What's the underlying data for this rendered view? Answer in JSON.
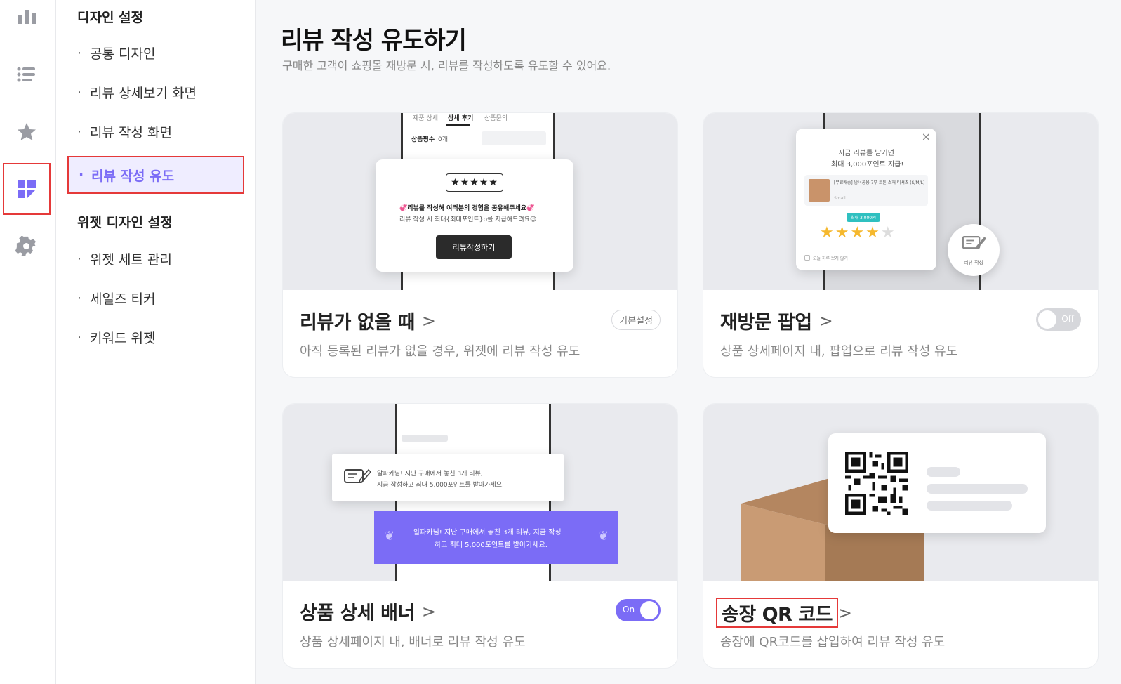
{
  "rail": {
    "items": [
      {
        "name": "chart-icon"
      },
      {
        "name": "list-icon"
      },
      {
        "name": "star-icon"
      },
      {
        "name": "widget-icon",
        "active": true
      },
      {
        "name": "gear-icon"
      }
    ]
  },
  "submenu": {
    "group1": "디자인 설정",
    "items1": [
      "공통 디자인",
      "리뷰 상세보기 화면",
      "리뷰 작성 화면",
      "리뷰 작성 유도"
    ],
    "group2": "위젯 디자인 설정",
    "items2": [
      "위젯 세트 관리",
      "세일즈 티커",
      "키워드 위젯"
    ],
    "bullet": "·"
  },
  "page": {
    "title": "리뷰 작성 유도하기",
    "subtitle": "구매한 고객이 쇼핑몰 재방문 시, 리뷰를 작성하도록 유도할 수 있어요."
  },
  "cards": [
    {
      "title": "리뷰가 없을 때",
      "desc": "아직 등록된 리뷰가 없을 경우, 위젯에 리뷰 작성 유도",
      "badge": "기본설정",
      "preview": {
        "tabs": [
          "제품 상세",
          "상세 후기",
          "상품문의"
        ],
        "rating_label": "상품평수",
        "rating_count": "0개",
        "stars": "★★★★★",
        "line1": "💞리뷰를 작성해 여러분의 경험을 공유해주세요💞",
        "line2": "리뷰 작성 시 최대{최대포인트}p를 지급해드려요😉",
        "button": "리뷰작성하기"
      }
    },
    {
      "title": "재방문 팝업",
      "desc": "상품 상세페이지 내, 팝업으로 리뷰 작성 유도",
      "toggle": "Off",
      "preview": {
        "close": "×",
        "line1": "지금 리뷰를 남기면",
        "line2": "최대 3,000포인트 지급!",
        "product_name": "[무료배송] 남녀공용 7부 코튼 소재 티셔츠 (S/M/L)",
        "product_opt": "Small",
        "chip": "최대 3,000P!",
        "stars_on": "★★★★",
        "stars_off": "★",
        "checkbox_label": "오늘 하루 보지 않기",
        "fab_label": "리뷰 작성"
      }
    },
    {
      "title": "상품 상세 배너",
      "desc": "상품 상세페이지 내, 배너로 리뷰 작성 유도",
      "toggle": "On",
      "preview": {
        "white_line1": "알파카님! 지난 구매에서 놓친 3개 리뷰,",
        "white_line2": "지금 작성하고 최대 5,000포인트를 받아가세요.",
        "purple_line1": "알파카님! 지난 구매에서 놓친 3개 리뷰, 지금 작성",
        "purple_line2": "하고 최대 5,000포인트를 받아가세요."
      }
    },
    {
      "title": "송장 QR 코드",
      "desc": "송장에 QR코드를 삽입하여 리뷰 작성 유도"
    }
  ],
  "colors": {
    "accent": "#7b6cf6",
    "highlight": "#e53939",
    "star": "#f5b82e"
  }
}
